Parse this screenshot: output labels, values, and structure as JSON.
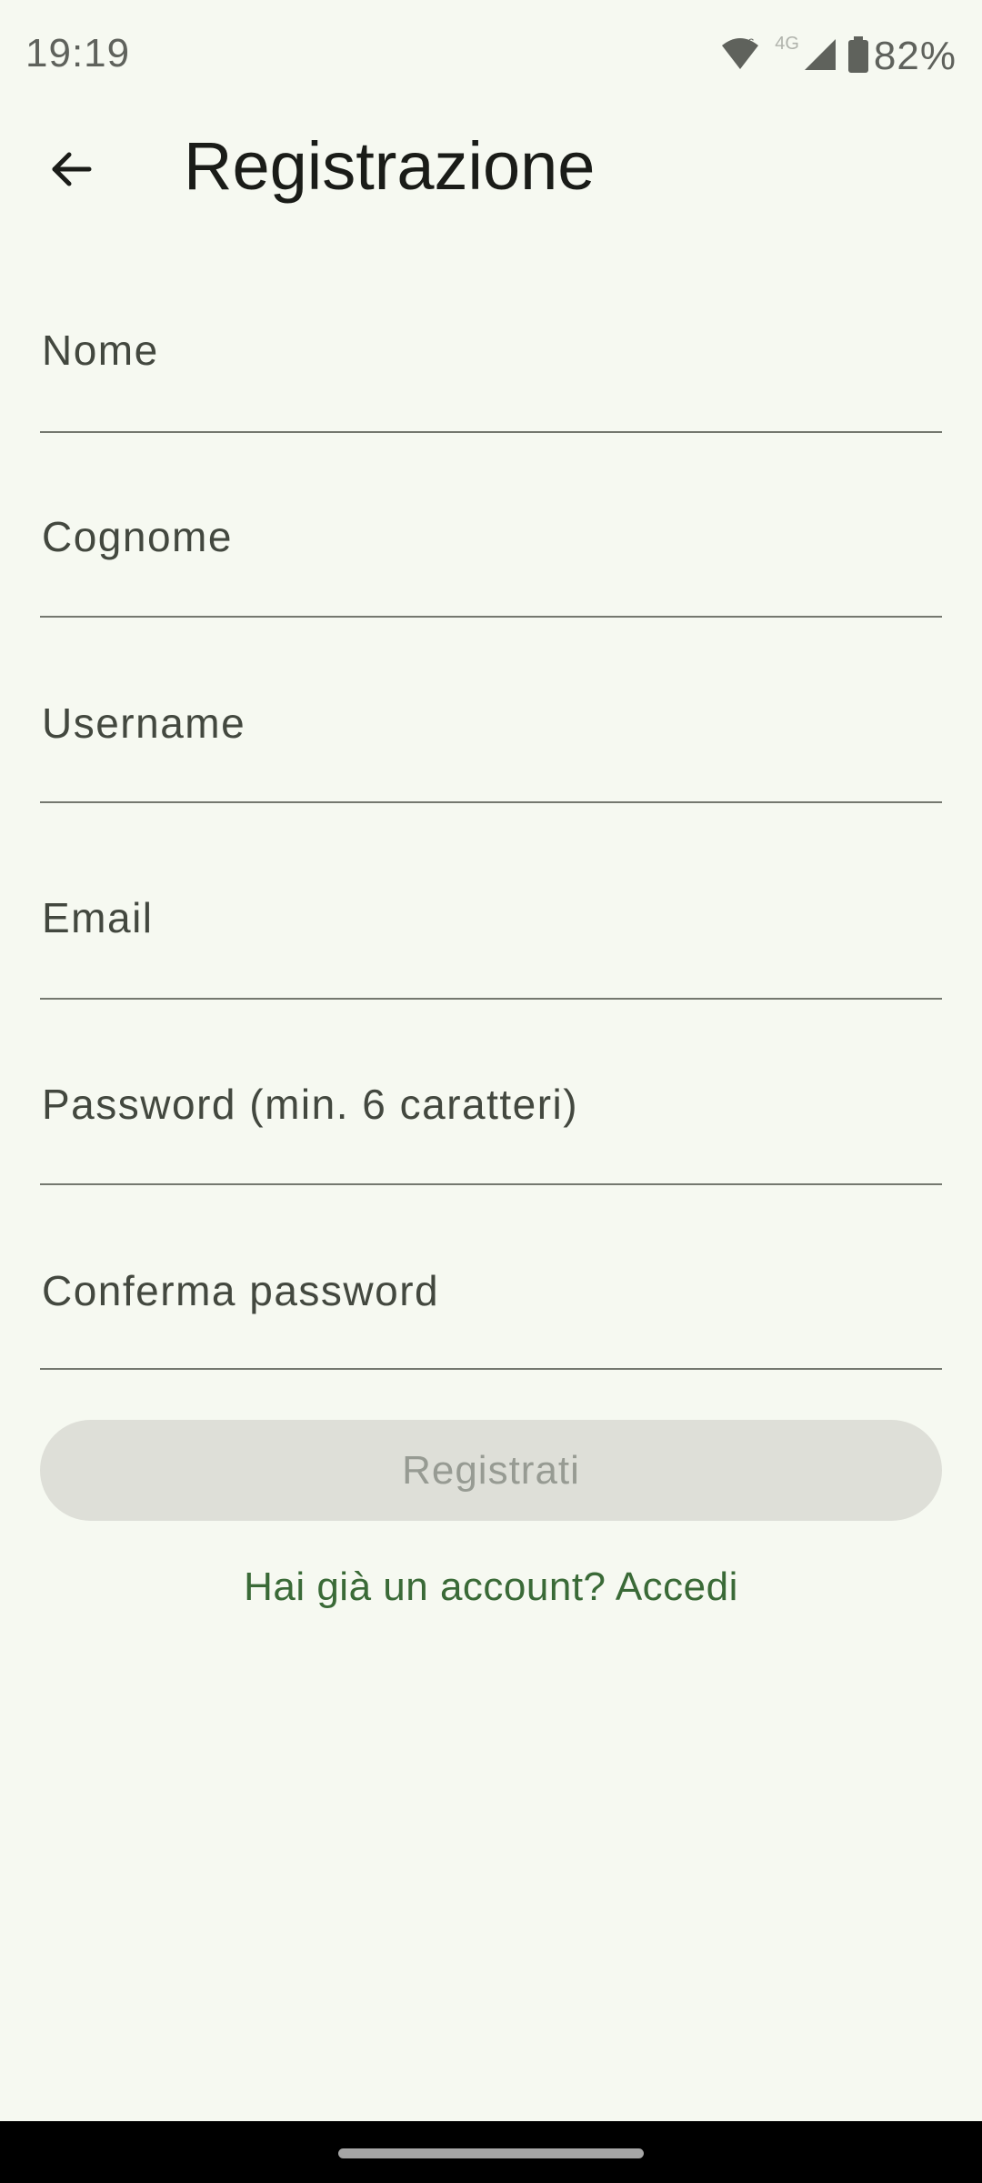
{
  "status_bar": {
    "time": "19:19",
    "network_label": "4G",
    "battery_percent": "82%",
    "icons": [
      "wifi-icon",
      "cell-signal-icon",
      "battery-icon"
    ]
  },
  "app_bar": {
    "back_icon": "arrow-back-icon",
    "title": "Registrazione"
  },
  "form": {
    "fields": [
      {
        "label": "Nome",
        "value": ""
      },
      {
        "label": "Cognome",
        "value": ""
      },
      {
        "label": "Username",
        "value": ""
      },
      {
        "label": "Email",
        "value": ""
      },
      {
        "label": "Password (min. 6 caratteri)",
        "value": ""
      },
      {
        "label": "Conferma password",
        "value": ""
      }
    ],
    "submit_label": "Registrati",
    "submit_enabled": false,
    "login_link": "Hai già un account? Accedi"
  },
  "colors": {
    "background": "#f6f9f1",
    "accent": "#3a6a37",
    "disabled_button": "#dedfd8"
  }
}
